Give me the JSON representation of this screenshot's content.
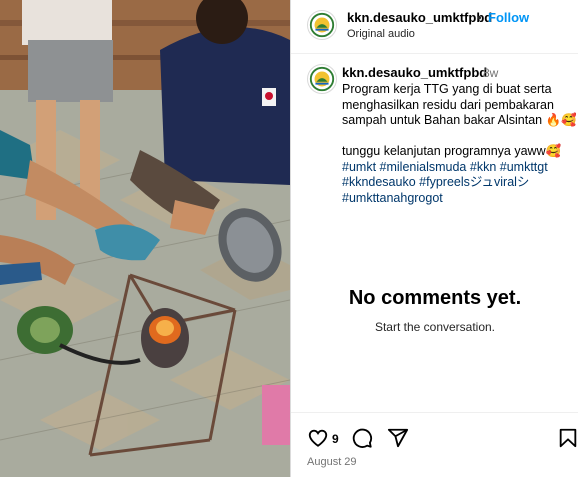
{
  "header": {
    "username": "kkn.desauko_umktfpbd",
    "separator": "•",
    "follow_label": "Follow",
    "audio": "Original audio",
    "avatar_icon": "desauko-logo-icon"
  },
  "caption": {
    "username": "kkn.desauko_umktfpbd",
    "time_ago": "8w",
    "lines": [
      "Program kerja TTG yang di buat serta",
      "menghasilkan residu dari pembakaran",
      "sampah untuk Bahan bakar Alsintan 🔥🥰"
    ],
    "line2": "tunggu kelanjutan programnya yaww🥰",
    "hashtag_lines": [
      [
        "#umkt",
        "#milenialsmuda",
        "#kkn",
        "#umkttgt"
      ],
      [
        "#kkndesauko",
        "#fypreelsジュviralシ"
      ],
      [
        "#umkttanahgrogot"
      ]
    ]
  },
  "comments": {
    "empty_title": "No comments yet.",
    "empty_subtitle": "Start the conversation."
  },
  "actions": {
    "like_count": "9",
    "date": "August 29",
    "icons": [
      "heart-icon",
      "comment-icon",
      "share-icon",
      "bookmark-icon"
    ]
  },
  "colors": {
    "accent": "#0095f6",
    "hashtag": "#00376b",
    "muted": "#737373",
    "divider": "#dbdbdb"
  }
}
